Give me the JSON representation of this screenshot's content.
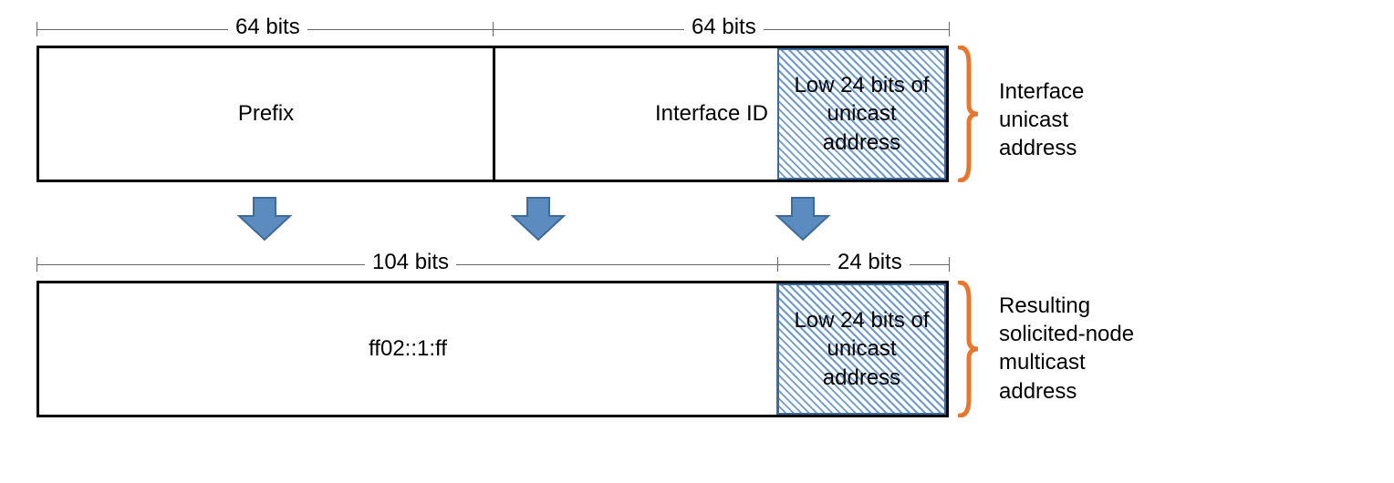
{
  "top": {
    "dim_left": "64 bits",
    "dim_right": "64 bits",
    "cell_prefix": "Prefix",
    "cell_interface_id": "Interface ID",
    "cell_low24": "Low 24 bits of\nunicast\naddress",
    "side_label": "Interface\nunicast\naddress"
  },
  "bottom": {
    "dim_left": "104 bits",
    "dim_right": "24 bits",
    "cell_prefix": "ff02::1:ff",
    "cell_low24": "Low 24 bits of\nunicast\naddress",
    "side_label": "Resulting\nsolicited-node\nmulticast\naddress"
  }
}
